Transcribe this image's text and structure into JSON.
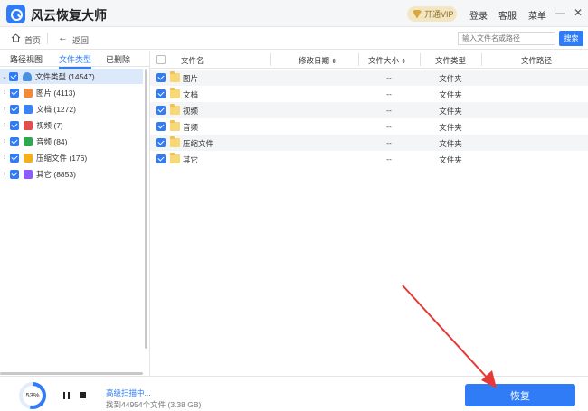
{
  "app": {
    "title": "风云恢复大师",
    "vip_label": "开通VIP",
    "login": "登录",
    "service": "客服",
    "menu": "菜单",
    "minimize": "—",
    "close": "✕"
  },
  "toolbar": {
    "home": "首页",
    "back": "返回",
    "search_placeholder": "输入文件名或路径",
    "search_button": "搜索"
  },
  "sidebar": {
    "tabs": [
      {
        "label": "路径视图"
      },
      {
        "label": "文件类型"
      },
      {
        "label": "已删除"
      }
    ],
    "tree": [
      {
        "label": "文件类型 (14547)",
        "icon": "drive-icon",
        "color": "#4a90e2"
      },
      {
        "label": "图片 (4113)",
        "icon": "image-icon",
        "color": "#f08a3c"
      },
      {
        "label": "文档 (1272)",
        "icon": "document-icon",
        "color": "#3b82f6"
      },
      {
        "label": "视频 (7)",
        "icon": "video-icon",
        "color": "#e04e4e"
      },
      {
        "label": "音频 (84)",
        "icon": "audio-icon",
        "color": "#2fa84f"
      },
      {
        "label": "压缩文件 (176)",
        "icon": "archive-icon",
        "color": "#f2b01e"
      },
      {
        "label": "其它 (8853)",
        "icon": "other-icon",
        "color": "#8b5cf6"
      }
    ]
  },
  "table": {
    "headers": {
      "name": "文件名",
      "date": "修改日期",
      "size": "文件大小",
      "type": "文件类型",
      "path": "文件路径"
    },
    "rows": [
      {
        "name": "图片",
        "size": "--",
        "type": "文件夹"
      },
      {
        "name": "文档",
        "size": "--",
        "type": "文件夹"
      },
      {
        "name": "视频",
        "size": "--",
        "type": "文件夹"
      },
      {
        "name": "音频",
        "size": "--",
        "type": "文件夹"
      },
      {
        "name": "压缩文件",
        "size": "--",
        "type": "文件夹"
      },
      {
        "name": "其它",
        "size": "--",
        "type": "文件夹"
      }
    ]
  },
  "status": {
    "progress_label": "53%",
    "progress": 0.53,
    "scanning": "高级扫描中...",
    "found": "找到44954个文件 (3.38 GB)",
    "recover_button": "恢复"
  },
  "colors": {
    "accent": "#2f7cf6",
    "annotation": "#e53935"
  }
}
